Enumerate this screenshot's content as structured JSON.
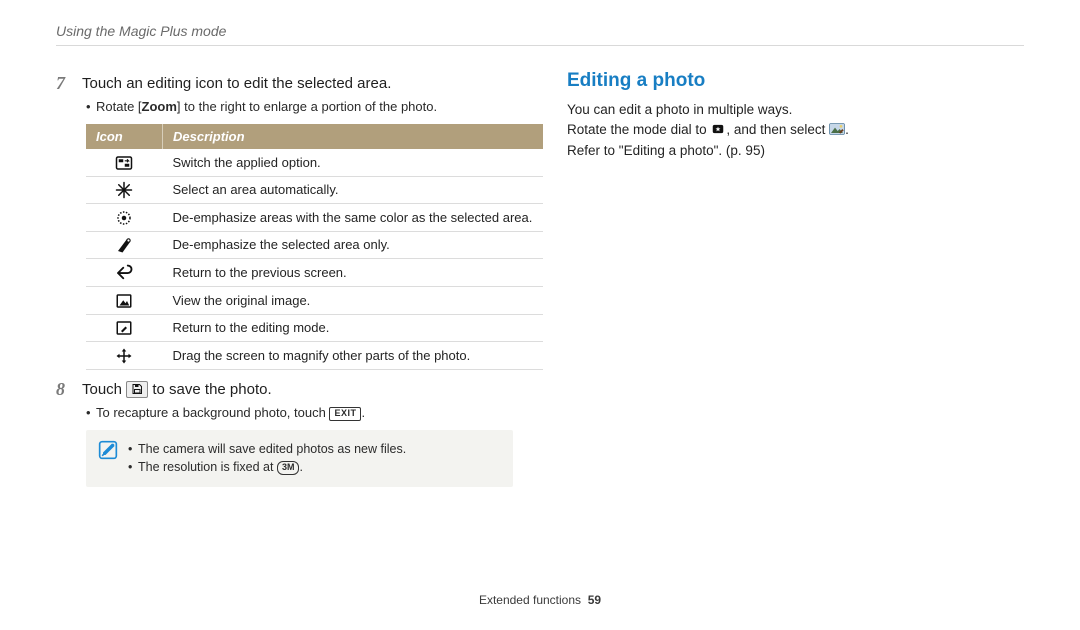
{
  "running_head": "Using the Magic Plus mode",
  "left": {
    "step7": {
      "num": "7",
      "text": "Touch an editing icon to edit the selected area.",
      "sub_pre": "Rotate [",
      "sub_bold": "Zoom",
      "sub_post": "] to the right to enlarge a portion of the photo."
    },
    "table": {
      "h_icon": "Icon",
      "h_desc": "Description",
      "rows": [
        "Switch the applied option.",
        "Select an area automatically.",
        "De-emphasize areas with the same color as the selected area.",
        "De-emphasize the selected area only.",
        "Return to the previous screen.",
        "View the original image.",
        "Return to the editing mode.",
        "Drag the screen to magnify other parts of the photo."
      ]
    },
    "step8": {
      "num": "8",
      "pre": "Touch ",
      "post": " to save the photo.",
      "sub_pre": "To recapture a background photo, touch ",
      "exit": "EXIT",
      "sub_post": "."
    },
    "note": {
      "l1": "The camera will save edited photos as new files.",
      "l2_pre": "The resolution is fixed at ",
      "l2_badge": "3M",
      "l2_post": "."
    }
  },
  "right": {
    "heading": "Editing a photo",
    "p1": "You can edit a photo in multiple ways.",
    "p2_pre": "Rotate the mode dial to ",
    "p2_mid": ", and then select ",
    "p2_post": ".",
    "p3": "Refer to \"Editing a photo\". (p. 95)"
  },
  "footer": {
    "section": "Extended functions",
    "page": "59"
  }
}
